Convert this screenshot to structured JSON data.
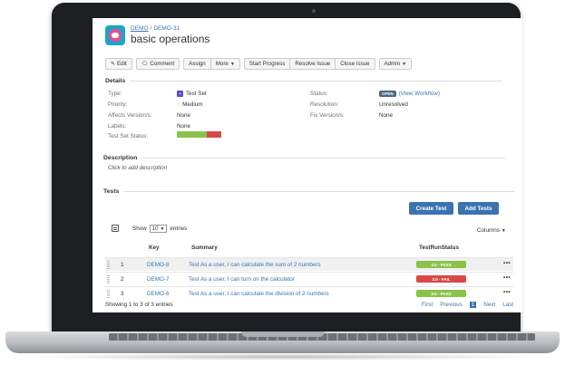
{
  "breadcrumb": {
    "project": "DEMO",
    "separator": "/",
    "issue_key": "DEMO-31"
  },
  "issue": {
    "summary": "basic operations"
  },
  "toolbar": {
    "edit": "Edit",
    "comment": "Comment",
    "assign": "Assign",
    "more": "More",
    "start_progress": "Start Progress",
    "resolve_issue": "Resolve Issue",
    "close_issue": "Close Issue",
    "admin": "Admin"
  },
  "details": {
    "heading": "Details",
    "type_label": "Type:",
    "type_value": "Test Set",
    "priority_label": "Priority:",
    "priority_value": "Medium",
    "affects_label": "Affects Version/s:",
    "affects_value": "None",
    "labels_label": "Labels:",
    "labels_value": "None",
    "test_set_status_label": "Test Set Status:",
    "test_set_status_pass_fraction": 0.67,
    "status_label": "Status:",
    "status_value": "OPEN",
    "view_workflow": "(View Workflow)",
    "resolution_label": "Resolution:",
    "resolution_value": "Unresolved",
    "fix_label": "Fix Version/s:",
    "fix_value": "None"
  },
  "description": {
    "heading": "Description",
    "placeholder": "Click to add description"
  },
  "tests": {
    "heading": "Tests",
    "create_test": "Create Test",
    "add_tests": "Add Tests",
    "show_label": "Show",
    "entries_count": "10",
    "entries_label": "entries",
    "columns_label": "Columns",
    "headers": {
      "key": "Key",
      "summary": "Summary",
      "status": "TestRunStatus"
    },
    "rows": [
      {
        "num": "1",
        "key": "DEMO-8",
        "summary": "Test As a user, I can calculate the sum of 2 numbers",
        "status": "3.0 - PASS",
        "state": "pass"
      },
      {
        "num": "2",
        "key": "DEMO-7",
        "summary": "Test As a user, I can turn on the calculator",
        "status": "3.0 - FAIL",
        "state": "fail"
      },
      {
        "num": "3",
        "key": "DEMO-6",
        "summary": "Test As a user, I can calculate the division of 2 numbers",
        "status": "3.0 - PASS",
        "state": "pass"
      }
    ],
    "more": "•••",
    "showing": "Showing 1 to 3 of 3 entries",
    "pager": {
      "first": "First",
      "previous": "Previous",
      "current": "1",
      "next": "Next",
      "last": "Last"
    }
  },
  "colors": {
    "accent": "#3b73af",
    "pass": "#8bc34a",
    "fail": "#d84848",
    "lozenge": "#4a6785"
  },
  "icons": {
    "avatar": "project-avatar",
    "edit": "pencil-icon",
    "comment": "speech-bubble-icon",
    "type": "test-set-icon",
    "priority": "arrow-up-icon",
    "grid": "grid-icon"
  }
}
